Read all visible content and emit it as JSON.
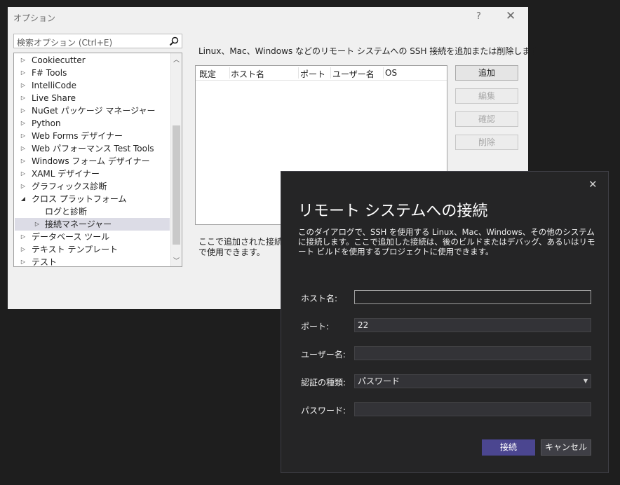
{
  "options_dialog": {
    "title": "オプション",
    "help_glyph": "?",
    "close_glyph": "✕",
    "search_placeholder": "検索オプション (Ctrl+E)",
    "tree": {
      "items": [
        {
          "label": "Cookiecutter",
          "expander": "▷"
        },
        {
          "label": "F# Tools",
          "expander": "▷"
        },
        {
          "label": "IntelliCode",
          "expander": "▷"
        },
        {
          "label": "Live Share",
          "expander": "▷"
        },
        {
          "label": "NuGet パッケージ マネージャー",
          "expander": "▷"
        },
        {
          "label": "Python",
          "expander": "▷"
        },
        {
          "label": "Web Forms デザイナー",
          "expander": "▷"
        },
        {
          "label": "Web パフォーマンス Test Tools",
          "expander": "▷"
        },
        {
          "label": "Windows フォーム デザイナー",
          "expander": "▷"
        },
        {
          "label": "XAML デザイナー",
          "expander": "▷"
        },
        {
          "label": "グラフィックス診断",
          "expander": "▷"
        },
        {
          "label": "クロス プラットフォーム",
          "expander": "◢"
        },
        {
          "label": "ログと診断",
          "expander": ""
        },
        {
          "label": "接続マネージャー",
          "expander": "▷"
        },
        {
          "label": "データベース ツール",
          "expander": "▷"
        },
        {
          "label": "テキスト テンプレート",
          "expander": "▷"
        },
        {
          "label": "テスト",
          "expander": "▷"
        }
      ]
    },
    "description_top": "Linux、Mac、Windows などのリモート システムへの SSH 接続を追加または削除します:",
    "grid_columns": [
      "既定",
      "ホスト名",
      "ポート",
      "ユーザー名",
      "OS"
    ],
    "buttons": {
      "add": "追加",
      "edit": "編集",
      "verify": "確認",
      "remove": "削除"
    },
    "description_bottom_1": "ここで追加された接続は、",
    "description_bottom_2": "で使用できます。"
  },
  "connect_dialog": {
    "close_glyph": "✕",
    "title": "リモート システムへの接続",
    "description": "このダイアログで、SSH を使用する Linux、Mac、Windows、その他のシステムに接続します。ここで追加した接続は、後のビルドまたはデバッグ、あるいはリモート ビルドを使用するプロジェクトに使用できます。",
    "fields": {
      "host_label": "ホスト名:",
      "host_value": "",
      "port_label": "ポート:",
      "port_value": "22",
      "user_label": "ユーザー名:",
      "user_value": "",
      "auth_label": "認証の種類:",
      "auth_value": "パスワード",
      "password_label": "パスワード:",
      "password_value": ""
    },
    "connect_button": "接続",
    "cancel_button": "キャンセル"
  }
}
